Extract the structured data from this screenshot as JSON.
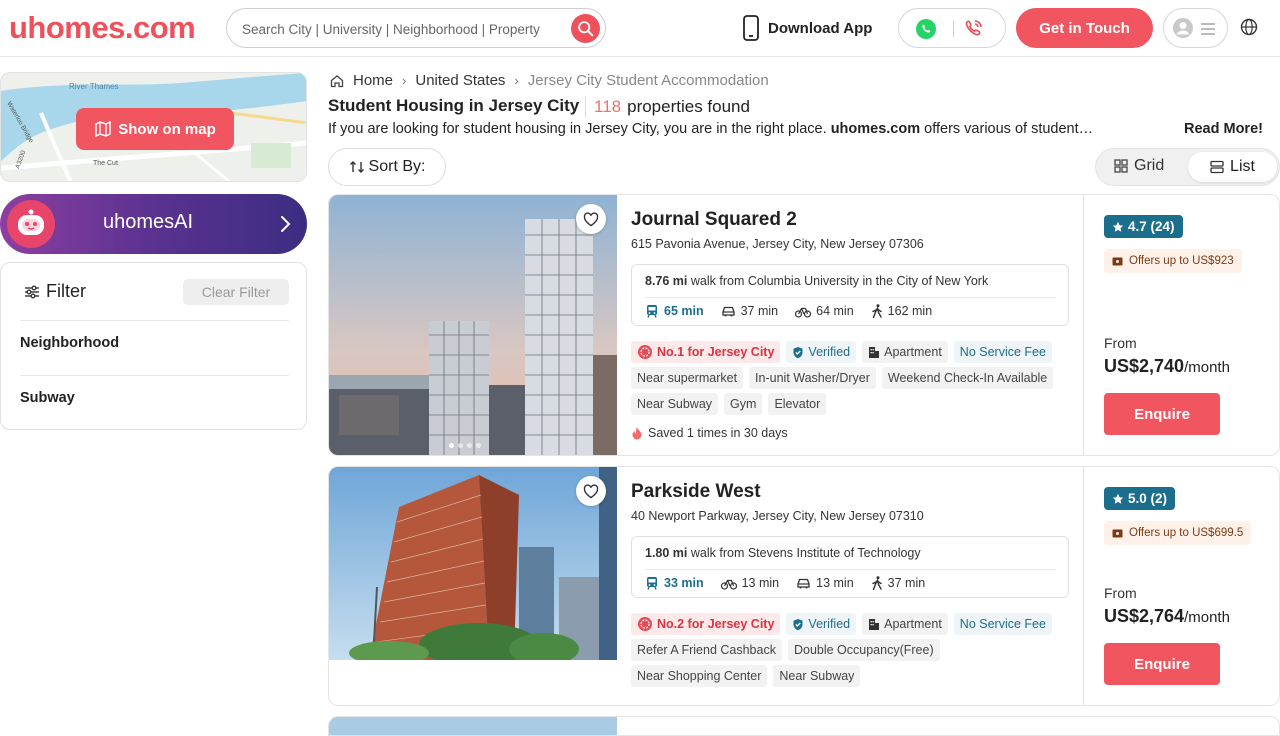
{
  "header": {
    "logo": "uhomes.com",
    "search_placeholder": "Search City | University | Neighborhood | Property",
    "download_app": "Download App",
    "get_in_touch": "Get in Touch",
    "colors": {
      "brand": "#f05560",
      "accent_teal": "#1b6e8c"
    }
  },
  "sidebar": {
    "show_on_map": "Show on map",
    "map_labels": [
      "River Thames",
      "Waterloo Bridge",
      "The Cut",
      "A3200"
    ],
    "ai_label": "uhomesAI",
    "filter_title": "Filter",
    "clear_filter": "Clear Filter",
    "filter_items": [
      "Neighborhood",
      "Subway"
    ]
  },
  "breadcrumb": {
    "home": "Home",
    "country": "United States",
    "current": "Jersey City Student Accommodation"
  },
  "page": {
    "title": "Student Housing in Jersey City",
    "count": "118",
    "count_suffix": "properties found",
    "intro_pre": "If you are looking for student housing in Jersey City, you are in the right place.",
    "intro_brand": "uhomes.com",
    "intro_post": "offers various of student…",
    "read_more": "Read More!",
    "sort_by": "Sort By:",
    "view_grid": "Grid",
    "view_list": "List"
  },
  "listings": [
    {
      "name": "Journal Squared 2",
      "address": "615 Pavonia Avenue, Jersey City, New Jersey 07306",
      "distance": "8.76 mi",
      "distance_text": "walk from Columbia University in the City of New York",
      "commute": {
        "transit": "65 min",
        "car": "37 min",
        "bike": "64 min",
        "walk": "162 min"
      },
      "rank": "No.1 for Jersey City",
      "verified": "Verified",
      "type": "Apartment",
      "tags": [
        "No Service Fee",
        "Near supermarket",
        "In-unit Washer/Dryer",
        "Weekend Check-In Available",
        "Near Subway",
        "Gym",
        "Elevator"
      ],
      "saved": "Saved 1 times in 30 days",
      "rating": "4.7 (24)",
      "offer": "Offers up to US$923",
      "from": "From",
      "price": "US$2,740",
      "per": "/month",
      "enquire": "Enquire"
    },
    {
      "name": "Parkside West",
      "address": "40 Newport Parkway, Jersey City, New Jersey 07310",
      "distance": "1.80 mi",
      "distance_text": "walk from Stevens Institute of Technology",
      "commute": {
        "transit": "33 min",
        "bike": "13 min",
        "car": "13 min",
        "walk": "37 min"
      },
      "rank": "No.2 for Jersey City",
      "verified": "Verified",
      "type": "Apartment",
      "tags": [
        "No Service Fee",
        "Refer A Friend Cashback",
        "Double Occupancy(Free)",
        "Near Shopping Center",
        "Near Subway"
      ],
      "rating": "5.0 (2)",
      "offer": "Offers up to US$699.5",
      "from": "From",
      "price": "US$2,764",
      "per": "/month",
      "enquire": "Enquire"
    }
  ]
}
